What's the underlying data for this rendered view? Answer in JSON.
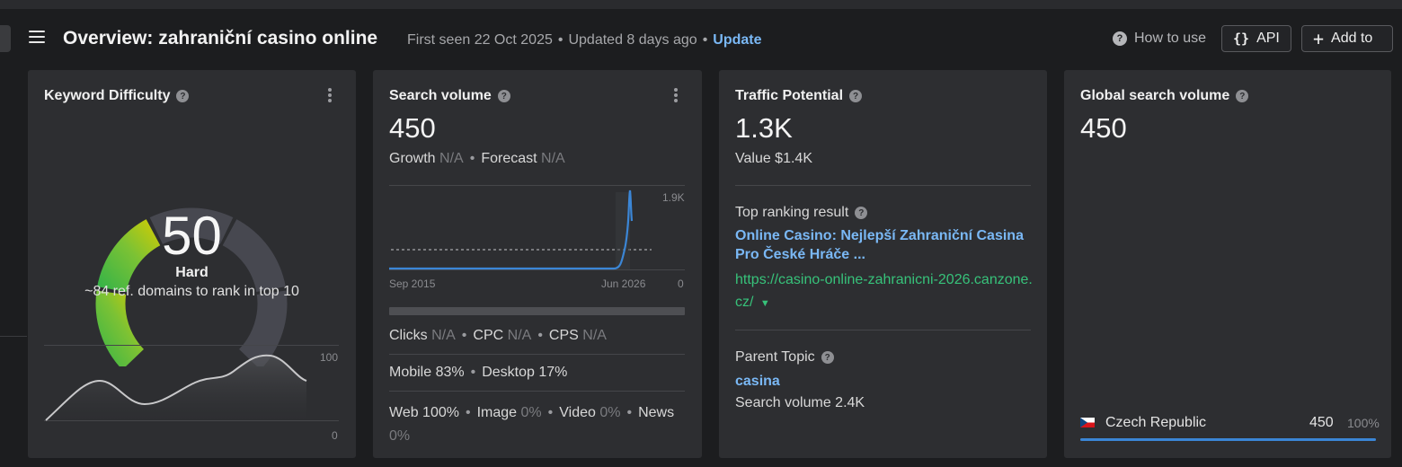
{
  "header": {
    "title": "Overview: zahraniční casino online",
    "first_seen": "First seen 22 Oct 2025",
    "updated": "Updated 8 days ago",
    "update_label": "Update",
    "how_to_use": "How to use",
    "api_label": "API",
    "add_to_label": "Add to"
  },
  "kd_card": {
    "title": "Keyword Difficulty",
    "score": "50",
    "score_value": 50,
    "level": "Hard",
    "ref_domains": "~84 ref. domains to rank in top 10",
    "chart_max": "100",
    "chart_min": "0"
  },
  "sv_card": {
    "title": "Search volume",
    "value": "450",
    "growth_label": "Growth",
    "growth_value": "N/A",
    "forecast_label": "Forecast",
    "forecast_value": "N/A",
    "chart_max": "1.9K",
    "chart_min": "0",
    "date_start": "Sep 2015",
    "date_end": "Jun 2026",
    "clicks_label": "Clicks",
    "clicks_value": "N/A",
    "cpc_label": "CPC",
    "cpc_value": "N/A",
    "cps_label": "CPS",
    "cps_value": "N/A",
    "mobile": "Mobile 83%",
    "desktop": "Desktop 17%",
    "web_label": "Web 100%",
    "image_label": "Image",
    "image_value": "0%",
    "video_label": "Video",
    "video_value": "0%",
    "news_label": "News",
    "news_value": "0%"
  },
  "tp_card": {
    "title": "Traffic Potential",
    "value": "1.3K",
    "traffic_value": "Value $1.4K",
    "top_ranking_label": "Top ranking result",
    "top_result_title": "Online Casino: Nejlepší Zahraniční Casina Pro České Hráče ...",
    "top_result_url": "https://casino-online-zahranicni-2026.canzone.cz/",
    "parent_topic_label": "Parent Topic",
    "parent_topic": "casina",
    "parent_volume": "Search volume 2.4K"
  },
  "gsv_card": {
    "title": "Global search volume",
    "value": "450",
    "country": "Czech Republic",
    "country_volume": "450",
    "country_share": "100%",
    "country_share_value": 100
  },
  "colors": {
    "accent_blue": "#7ab8f5",
    "url_green": "#37c27a",
    "gauge_green": "#2fb24a",
    "gauge_yellow": "#d8cd00",
    "line_blue": "#3b86d6"
  }
}
